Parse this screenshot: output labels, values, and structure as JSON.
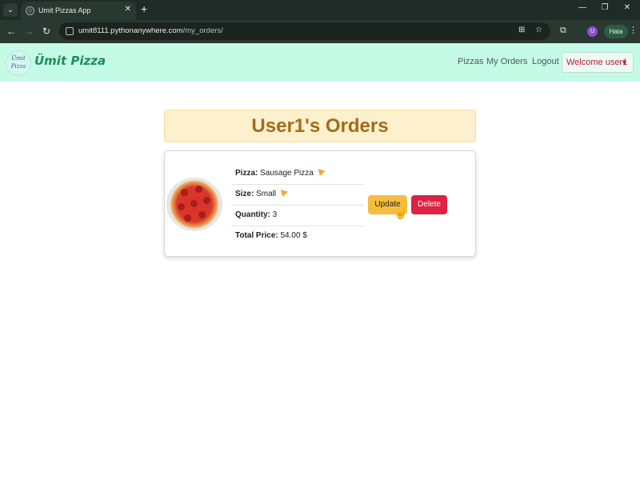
{
  "browser": {
    "tab_title": "Umit Pizzas App",
    "url_host": "umit8111.pythonanywhere.com",
    "url_path": "/my_orders/",
    "profile_initial": "U",
    "status_chip": "Hata"
  },
  "navbar": {
    "logo_line1": "Ümit",
    "logo_line2": "Pizza",
    "brand": "Ümit Pizza",
    "links": [
      "Pizzas",
      "My Orders",
      "Logout"
    ],
    "welcome": "Welcome user1"
  },
  "page": {
    "heading": "User1's Orders"
  },
  "order": {
    "pizza_label": "Pizza:",
    "pizza_value": "Sausage Pizza",
    "size_label": "Size:",
    "size_value": "Small",
    "quantity_label": "Quantity:",
    "quantity_value": "3",
    "price_label": "Total Price:",
    "price_value": "54.00 $",
    "update_label": "Update",
    "delete_label": "Delete"
  },
  "colors": {
    "navbar_bg": "#c3fbe6",
    "brand": "#1f8c5a",
    "heading_text": "#a36b1c",
    "update_btn": "#f4bd3f",
    "delete_btn": "#dc2245",
    "welcome_text": "#c4152d"
  },
  "icons": [
    "tab-list-icon",
    "globe-icon",
    "close-icon",
    "plus-icon",
    "minimize-icon",
    "restore-icon",
    "back-icon",
    "forward-icon",
    "reload-icon",
    "site-info-icon",
    "translate-icon",
    "star-icon",
    "extensions-icon",
    "kebab-menu-icon",
    "pizza-slice-icon",
    "caret-down-icon",
    "hand-cursor-icon"
  ]
}
